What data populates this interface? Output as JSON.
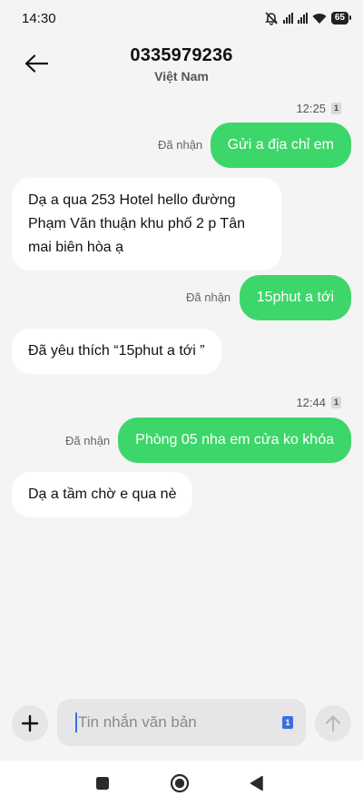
{
  "status_bar": {
    "time": "14:30",
    "battery": "65"
  },
  "header": {
    "contact": "0335979236",
    "subtitle": "Việt Nam"
  },
  "messages": [
    {
      "time": "12:25",
      "sim": "1"
    },
    {
      "text": "Gửi a địa chỉ em",
      "status": "Đã nhận"
    },
    {
      "text_lines": [
        "Dạ a qua 253 Hotel hello đường",
        "Phạm Văn thuận khu phố 2 p Tân",
        "mai biên hòa ạ"
      ]
    },
    {
      "text": "15phut a tới",
      "status": "Đã nhận"
    },
    {
      "text": "Đã yêu thích “15phut a tới ”"
    },
    {
      "time": "12:44",
      "sim": "1"
    },
    {
      "text": "Phòng 05 nha em cửa ko khóa",
      "status": "Đã nhận"
    },
    {
      "text": "Dạ a tầm chờ e qua nè"
    }
  ],
  "composer": {
    "placeholder": "Tin nhắn văn bản",
    "sim": "1"
  },
  "icons": {
    "back": "arrow-left-icon",
    "add": "plus-icon",
    "send": "arrow-up-icon",
    "mute": "bell-off-icon",
    "wifi": "wifi-icon",
    "signal": "signal-icon",
    "nav_recent": "square-icon",
    "nav_home": "circle-icon",
    "nav_back": "triangle-icon"
  },
  "colors": {
    "outgoing_bubble": "#3dd66a",
    "incoming_bubble": "#ffffff",
    "background": "#f4f4f5",
    "accent": "#3b6fe0"
  }
}
